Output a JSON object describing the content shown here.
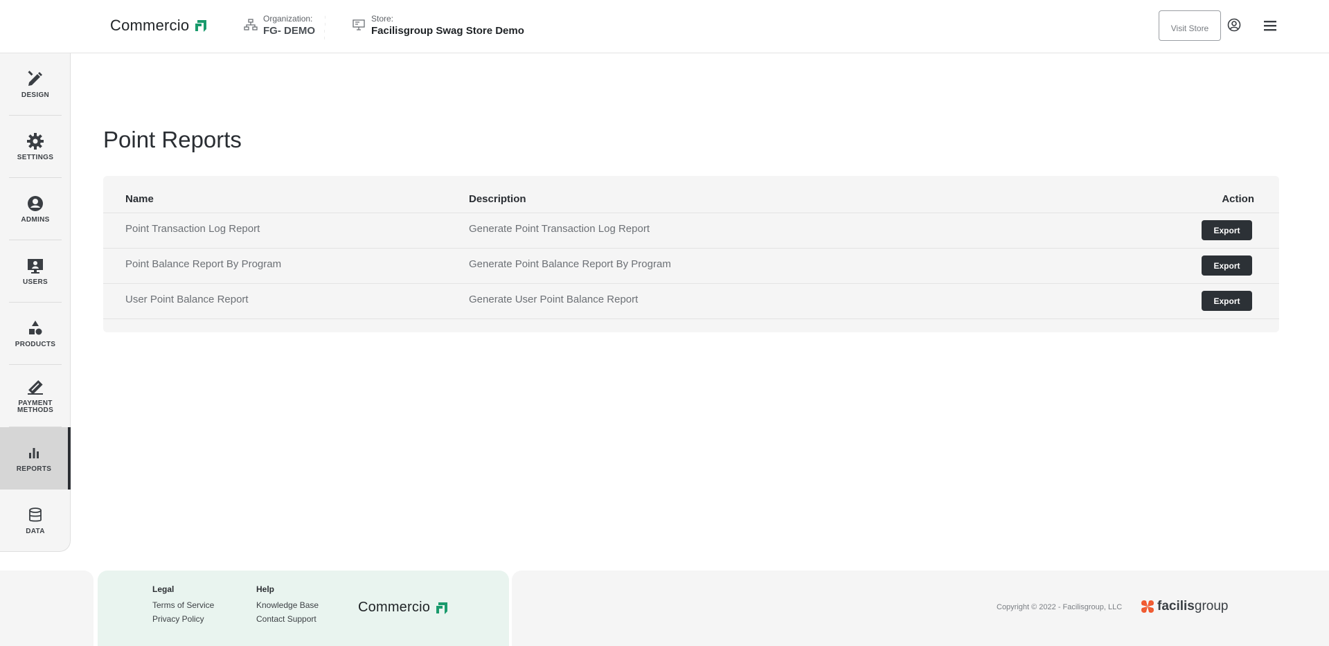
{
  "header": {
    "logo_text": "Commercio",
    "org_label": "Organization:",
    "org_value": "FG- DEMO",
    "store_label": "Store:",
    "store_value": "Facilisgroup Swag Store Demo",
    "visit_store_label": "Visit Store"
  },
  "sidebar": {
    "items": [
      {
        "label": "DESIGN",
        "icon": "design-icon"
      },
      {
        "label": "SETTINGS",
        "icon": "gear-icon"
      },
      {
        "label": "ADMINS",
        "icon": "admin-icon"
      },
      {
        "label": "USERS",
        "icon": "users-icon"
      },
      {
        "label": "PRODUCTS",
        "icon": "shapes-icon"
      },
      {
        "label": "PAYMENT METHODS",
        "icon": "payment-icon"
      },
      {
        "label": "REPORTS",
        "icon": "bar-chart-icon",
        "active": true
      },
      {
        "label": "DATA",
        "icon": "database-icon"
      }
    ]
  },
  "main": {
    "title": "Point Reports",
    "table": {
      "columns": {
        "name": "Name",
        "description": "Description",
        "action": "Action"
      },
      "rows": [
        {
          "name": "Point Transaction Log Report",
          "description": "Generate Point Transaction Log Report",
          "action": "Export"
        },
        {
          "name": "Point Balance Report By Program",
          "description": "Generate Point Balance Report By Program",
          "action": "Export"
        },
        {
          "name": "User Point Balance Report",
          "description": "Generate User Point Balance Report",
          "action": "Export"
        }
      ]
    }
  },
  "footer": {
    "legal_heading": "Legal",
    "terms": "Terms of Service",
    "privacy": "Privacy Policy",
    "help_heading": "Help",
    "knowledge_base": "Knowledge Base",
    "contact_support": "Contact Support",
    "logo_text": "Commercio",
    "copyright": "Copyright © 2022 - Facilisgroup, LLC",
    "brand_light": "facilis",
    "brand_bold": "group"
  },
  "colors": {
    "accent_green": "#1a9a6c",
    "brand_orange": "#f0582e",
    "dark_button": "#2c3136"
  }
}
